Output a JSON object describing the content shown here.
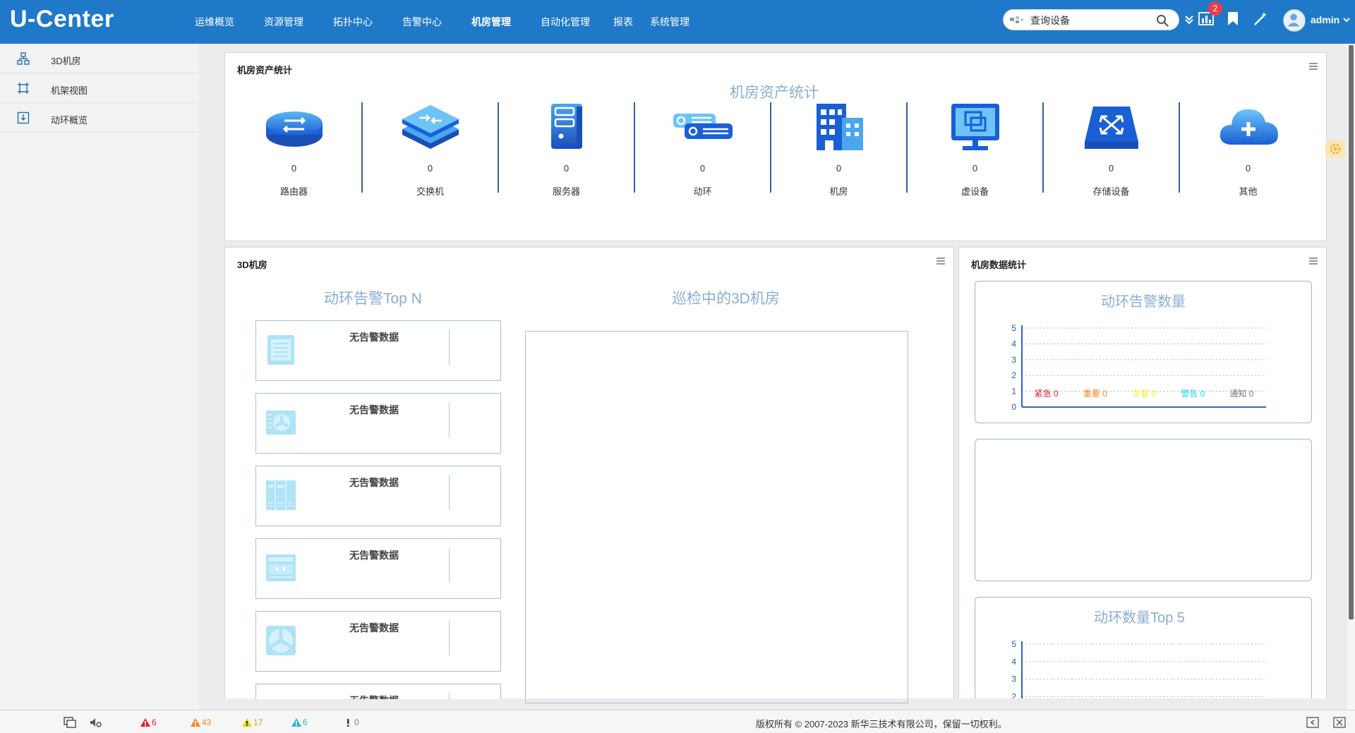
{
  "app": {
    "logo": "U-Center"
  },
  "nav": [
    {
      "label": "运维概览",
      "active": false
    },
    {
      "label": "资源管理",
      "active": false
    },
    {
      "label": "拓扑中心",
      "active": false
    },
    {
      "label": "告警中心",
      "active": false
    },
    {
      "label": "机房管理",
      "active": true
    },
    {
      "label": "自动化管理",
      "active": false
    },
    {
      "label": "报表",
      "active": false
    },
    {
      "label": "系统管理",
      "active": false
    }
  ],
  "search": {
    "placeholder": "查询设备"
  },
  "header": {
    "notification_count": "2",
    "user": "admin"
  },
  "sidebar": {
    "items": [
      {
        "label": "3D机房",
        "icon": "topology-icon"
      },
      {
        "label": "机架视图",
        "icon": "rack-frame-icon"
      },
      {
        "label": "动环概览",
        "icon": "env-overview-icon"
      }
    ]
  },
  "assets_panel": {
    "title": "机房资产统计",
    "heading": "机房资产统计",
    "items": [
      {
        "label": "路由器",
        "count": "0",
        "icon": "router-icon"
      },
      {
        "label": "交换机",
        "count": "0",
        "icon": "switch-icon"
      },
      {
        "label": "服务器",
        "count": "0",
        "icon": "server-icon"
      },
      {
        "label": "动环",
        "count": "0",
        "icon": "env-device-icon"
      },
      {
        "label": "机房",
        "count": "0",
        "icon": "building-icon"
      },
      {
        "label": "虚设备",
        "count": "0",
        "icon": "virtual-device-icon"
      },
      {
        "label": "存储设备",
        "count": "0",
        "icon": "storage-icon"
      },
      {
        "label": "其他",
        "count": "0",
        "icon": "cloud-plus-icon"
      }
    ]
  },
  "room_panel": {
    "title": "3D机房",
    "alarm_heading": "动环告警Top N",
    "viewer_heading": "巡检中的3D机房",
    "alarm_cards": [
      {
        "text": "无告警数据",
        "icon": "ups-icon"
      },
      {
        "text": "无告警数据",
        "icon": "air-conditioner-icon"
      },
      {
        "text": "无告警数据",
        "icon": "power-cabinet-icon"
      },
      {
        "text": "无告警数据",
        "icon": "distribution-box-icon"
      },
      {
        "text": "无告警数据",
        "icon": "fan-icon"
      },
      {
        "text": "无告警数据",
        "icon": "device-icon"
      }
    ]
  },
  "stats_panel": {
    "title": "机房数据统计",
    "alarm_count_heading": "动环告警数量",
    "top5_heading": "动环数量Top 5"
  },
  "chart_data": [
    {
      "type": "bar",
      "title": "动环告警数量",
      "categories": [
        "紧急",
        "重要",
        "次要",
        "警告",
        "通知"
      ],
      "values": [
        0,
        0,
        0,
        0,
        0
      ],
      "category_colors": [
        "#e0202e",
        "#f08a1c",
        "#f5ea2a",
        "#22d4e8",
        "#777777"
      ],
      "ylim": [
        0,
        5
      ],
      "yticks": [
        0,
        1,
        2,
        3,
        4,
        5
      ],
      "grid": true
    },
    {
      "type": "bar",
      "title": "动环数量Top 5",
      "categories": [],
      "values": [],
      "ylim": [
        0,
        5
      ],
      "yticks": [
        2,
        3,
        4,
        5
      ],
      "grid": true
    }
  ],
  "footer": {
    "alarms": [
      {
        "count": "6",
        "color": "#e0202e"
      },
      {
        "count": "43",
        "color": "#f08a1c"
      },
      {
        "count": "17",
        "color": "#e8d61c"
      },
      {
        "count": "6",
        "color": "#22b8d4"
      },
      {
        "count": "0",
        "color": "#777777"
      }
    ],
    "copyright": "版权所有 © 2007-2023 新华三技术有限公司，保留一切权利。"
  },
  "colors": {
    "header": "#1f79c8",
    "accent_heading": "#8aaecf",
    "separator": "#3a5f9a"
  }
}
